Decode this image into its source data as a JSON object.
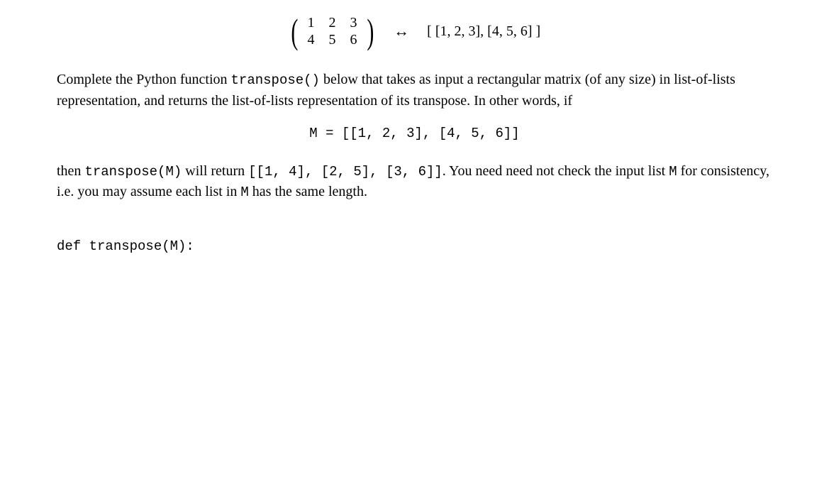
{
  "matrix": {
    "row1": {
      "c1": "1",
      "c2": "2",
      "c3": "3"
    },
    "row2": {
      "c1": "4",
      "c2": "5",
      "c3": "6"
    }
  },
  "arrow": "↔",
  "list_repr": "[ [1, 2, 3], [4, 5, 6] ]",
  "para1": {
    "t1": "Complete the Python function ",
    "code1": "transpose()",
    "t2": " below that takes as input a rectangular matrix (of any size) in list-of-lists representation, and returns the list-of-lists representation of its transpose.  In other words, if"
  },
  "code_line": "M = [[1, 2, 3], [4, 5, 6]]",
  "para2": {
    "t1": "then ",
    "code1": "transpose(M)",
    "t2": " will return ",
    "code2": "[[1, 4], [2, 5], [3, 6]]",
    "t3": ". You need need not check the input list ",
    "code3": "M",
    "t4": " for consistency, i.e. you may assume each list in ",
    "code4": "M",
    "t5": " has the same length."
  },
  "def_line": "def transpose(M):"
}
